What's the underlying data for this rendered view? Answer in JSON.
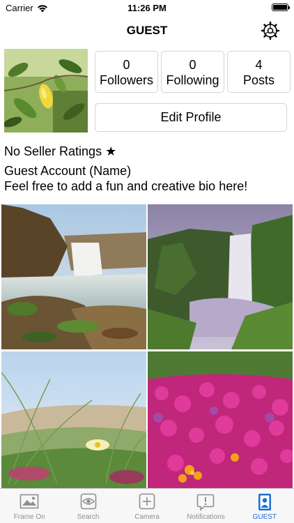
{
  "status_bar": {
    "carrier": "Carrier",
    "time": "11:26 PM"
  },
  "nav": {
    "title": "GUEST",
    "settings_icon": "gear-icon"
  },
  "profile": {
    "stats": [
      {
        "count": "0",
        "label": "Followers"
      },
      {
        "count": "0",
        "label": "Following"
      },
      {
        "count": "4",
        "label": "Posts"
      }
    ],
    "edit_label": "Edit Profile",
    "ratings": "No Seller Ratings ★",
    "name": "Guest Account (Name)",
    "bio": "Feel free to add a fun and creative bio here!"
  },
  "posts": [
    {
      "subject": "waterfall-canyon-photo"
    },
    {
      "subject": "waterfall-green-cliffs-photo"
    },
    {
      "subject": "dune-grass-flower-photo"
    },
    {
      "subject": "magenta-flower-field-photo"
    }
  ],
  "tabs": [
    {
      "label": "Frame On",
      "icon": "photo-icon",
      "active": false
    },
    {
      "label": "Search",
      "icon": "eye-icon",
      "active": false
    },
    {
      "label": "Camera",
      "icon": "plus-box-icon",
      "active": false
    },
    {
      "label": "Notifications",
      "icon": "alert-bubble-icon",
      "active": false
    },
    {
      "label": "GUEST",
      "icon": "profile-icon",
      "active": true
    }
  ],
  "colors": {
    "accent": "#1a6fd6",
    "tab_inactive": "#8e8e93",
    "border": "#d4d4d4"
  }
}
